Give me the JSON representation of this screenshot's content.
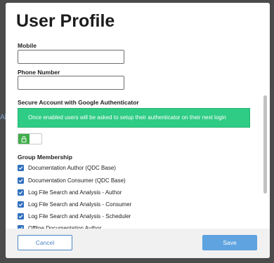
{
  "background": {
    "fragment_text": "Al"
  },
  "modal": {
    "title": "User Profile"
  },
  "form": {
    "mobile": {
      "label": "Mobile",
      "value": ""
    },
    "phone": {
      "label": "Phone Number",
      "value": ""
    },
    "authenticator": {
      "title": "Secure Account with Google Authenticator",
      "alert": "Once enabled users will be asked to setup their authenticator on their next login",
      "toggle_icon": "lock-icon"
    },
    "groups": {
      "title": "Group Membership",
      "items": [
        {
          "label": "Documentation Author (QDC Base)",
          "checked": true
        },
        {
          "label": "Documentation Consumer (QDC Base)",
          "checked": true
        },
        {
          "label": "Log File Search and Analysis - Author",
          "checked": true
        },
        {
          "label": "Log File Search and Analysis - Consumer",
          "checked": true
        },
        {
          "label": "Log File Search and Analysis - Scheduler",
          "checked": true
        },
        {
          "label": "Offline Documentation Author",
          "checked": true
        }
      ]
    }
  },
  "footer": {
    "cancel_label": "Cancel",
    "save_label": "Save"
  },
  "colors": {
    "success": "#2ecc85",
    "toggle_on": "#3fae49",
    "checkbox": "#2f6fbd",
    "primary": "#5fa4e0"
  }
}
